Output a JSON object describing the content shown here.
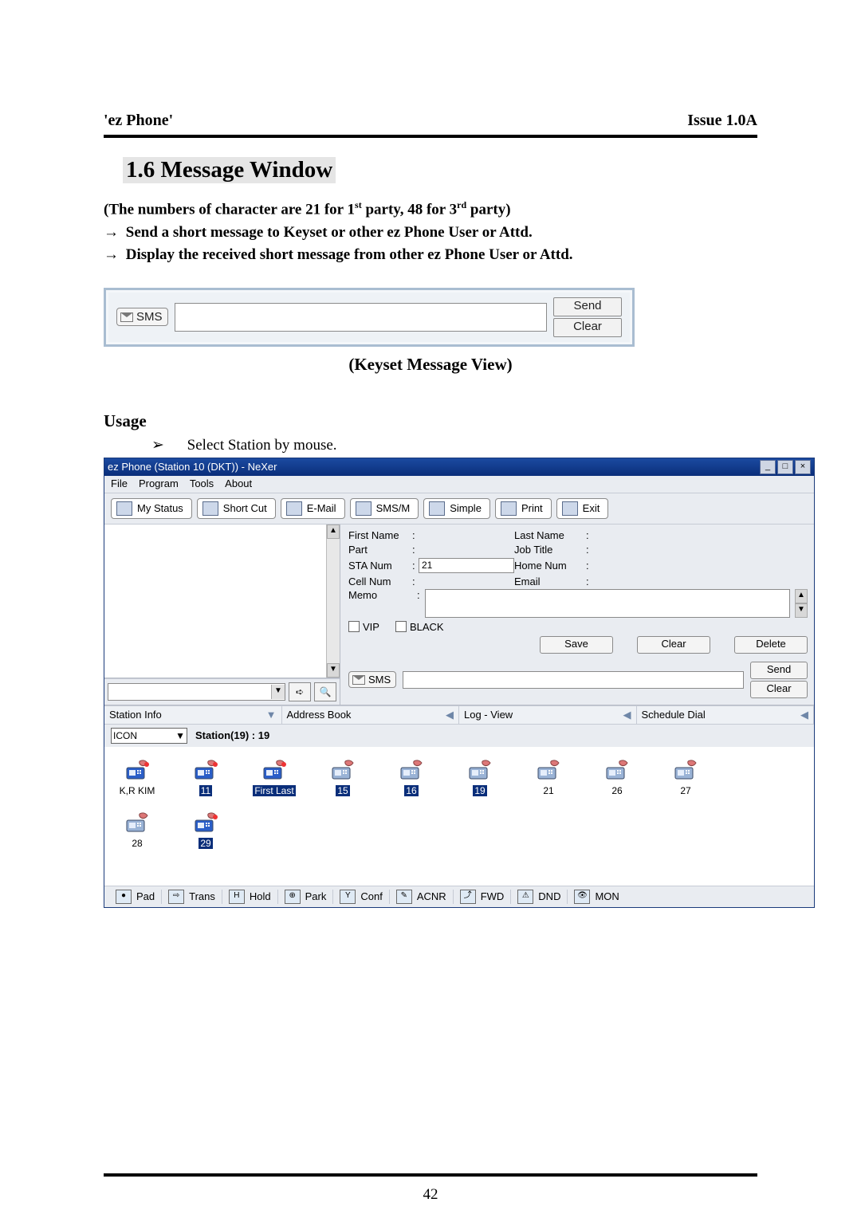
{
  "header": {
    "left": "'ez Phone'",
    "right": "Issue 1.0A"
  },
  "section_heading": "1.6 Message Window",
  "note_chars": "(The numbers of character are 21 for 1st party, 48 for 3rd party)",
  "note_chars_plain_prefix": "(The numbers of character are 21 for 1",
  "note_chars_mid": " party, 48 for 3",
  "note_chars_suffix": " party)",
  "sup1": "st",
  "sup2": "rd",
  "arrow": "→",
  "bullet1": "Send a short message to Keyset or other ez Phone User or Attd.",
  "bullet2": "Display the received short message from other ez Phone User or Attd.",
  "caption": "(Keyset Message View)",
  "usage_heading": "Usage",
  "usage_marker": "➢",
  "usage_item": "Select Station by mouse.",
  "page_number": "42",
  "sms_bar": {
    "chip": "SMS",
    "send": "Send",
    "clear": "Clear"
  },
  "app": {
    "title": "ez Phone (Station 10 (DKT)) - NeXer",
    "win_btns": {
      "min": "_",
      "max": "□",
      "close": "×"
    },
    "menu": [
      "File",
      "Program",
      "Tools",
      "About"
    ],
    "toolbar": [
      "My Status",
      "Short Cut",
      "E-Mail",
      "SMS/M",
      "Simple",
      "Print",
      "Exit"
    ],
    "form": {
      "first_name": "First Name",
      "last_name": "Last Name",
      "part": "Part",
      "job_title": "Job Title",
      "sta_num": "STA Num",
      "sta_num_val": "21",
      "home_num": "Home Num",
      "cell_num": "Cell Num",
      "email": "Email",
      "memo": "Memo",
      "vip": "VIP",
      "black": "BLACK",
      "save": "Save",
      "clear": "Clear",
      "delete": "Delete"
    },
    "sms2": {
      "chip": "SMS",
      "send": "Send",
      "clear": "Clear"
    },
    "tabs": [
      "Station Info",
      "Address Book",
      "Log - View",
      "Schedule Dial"
    ],
    "combo_value": "ICON",
    "station_label": "Station(19) :  19",
    "stations_row1": [
      {
        "label": "K,R KIM",
        "sel": false,
        "busy": true
      },
      {
        "label": "11",
        "sel": true,
        "busy": true
      },
      {
        "label": "First Last",
        "sel": true,
        "busy": true
      },
      {
        "label": "15",
        "sel": true,
        "busy": false
      },
      {
        "label": "16",
        "sel": true,
        "busy": false
      },
      {
        "label": "19",
        "sel": true,
        "busy": false
      },
      {
        "label": "21",
        "sel": false,
        "busy": false
      },
      {
        "label": "26",
        "sel": false,
        "busy": false
      },
      {
        "label": "27",
        "sel": false,
        "busy": false
      }
    ],
    "stations_row2": [
      {
        "label": "28",
        "sel": false,
        "busy": false
      },
      {
        "label": "29",
        "sel": true,
        "busy": true
      }
    ],
    "footer": [
      "Pad",
      "Trans",
      "Hold",
      "Park",
      "Conf",
      "ACNR",
      "FWD",
      "DND",
      "MON"
    ],
    "footer_icons": [
      "●",
      "⇨",
      "H",
      "⊕",
      "Y",
      "✎",
      "⤴",
      "⚠",
      "👁"
    ]
  }
}
